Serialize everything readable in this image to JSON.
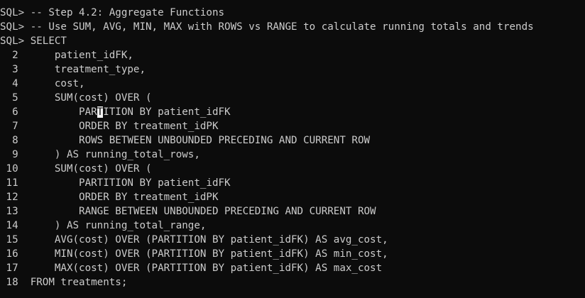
{
  "terminal": {
    "lines": [
      "SQL> -- Step 4.2: Aggregate Functions",
      "SQL> -- Use SUM, AVG, MIN, MAX with ROWS vs RANGE to calculate running totals and trends",
      "SQL> SELECT",
      "  2      patient_idFK,",
      "  3      treatment_type,",
      "  4      cost,",
      "  5      SUM(cost) OVER (",
      "  6          PARTITION BY patient_idFK",
      "  7          ORDER BY treatment_idPK",
      "  8          ROWS BETWEEN UNBOUNDED PRECEDING AND CURRENT ROW",
      "  9      ) AS running_total_rows,",
      " 10      SUM(cost) OVER (",
      " 11          PARTITION BY patient_idFK",
      " 12          ORDER BY treatment_idPK",
      " 13          RANGE BETWEEN UNBOUNDED PRECEDING AND CURRENT ROW",
      " 14      ) AS running_total_range,",
      " 15      AVG(cost) OVER (PARTITION BY patient_idFK) AS avg_cost,",
      " 16      MIN(cost) OVER (PARTITION BY patient_idFK) AS min_cost,",
      " 17      MAX(cost) OVER (PARTITION BY patient_idFK) AS max_cost",
      " 18  FROM treatments;"
    ],
    "cursor": {
      "line_index": 7,
      "before": "  6          PAR",
      "char": "T",
      "after": "ITION BY patient_idFK"
    },
    "colors": {
      "background": "#0c0c0c",
      "foreground": "#cccccc",
      "cursor": "#f2f2f2"
    }
  }
}
